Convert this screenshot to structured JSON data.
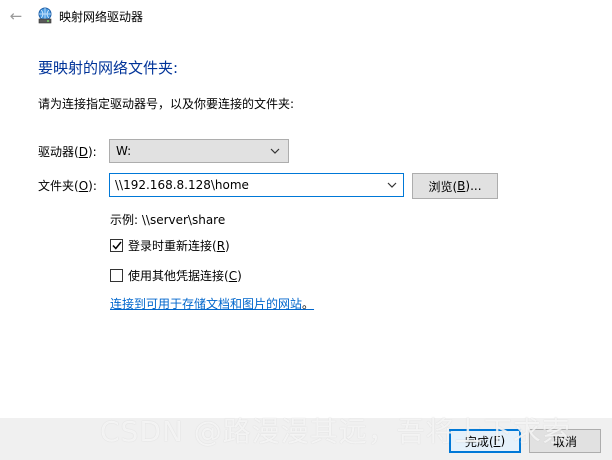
{
  "titlebar": {
    "title": "映射网络驱动器",
    "back_icon": "arrow-left-icon",
    "app_icon": "network-drive-icon"
  },
  "heading": "要映射的网络文件夹:",
  "instruction": "请为连接指定驱动器号，以及你要连接的文件夹:",
  "drive": {
    "label_pre": "驱动器(",
    "label_key": "D",
    "label_post": "):",
    "value": "W:"
  },
  "folder": {
    "label_pre": "文件夹(",
    "label_key": "O",
    "label_post": "):",
    "value": "\\\\192.168.8.128\\home"
  },
  "browse": {
    "label_pre": "浏览(",
    "label_key": "B",
    "label_post": ")..."
  },
  "example": "示例: \\\\server\\share",
  "reconnect": {
    "checked": true,
    "label_pre": "登录时重新连接(",
    "label_key": "R",
    "label_post": ")"
  },
  "other_credentials": {
    "checked": false,
    "label_pre": "使用其他凭据连接(",
    "label_key": "C",
    "label_post": ")"
  },
  "link": {
    "text": "连接到可用于存储文档和图片的网站",
    "suffix": "。"
  },
  "footer": {
    "finish_pre": "完成(",
    "finish_key": "F",
    "finish_post": ")",
    "cancel": "取消"
  },
  "watermark": "CSDN @路漫漫其远，吾将上下求索",
  "colors": {
    "heading": "#003399",
    "link": "#0066cc",
    "focus_border": "#0078d7",
    "footer_bg": "#f0f0f0"
  }
}
